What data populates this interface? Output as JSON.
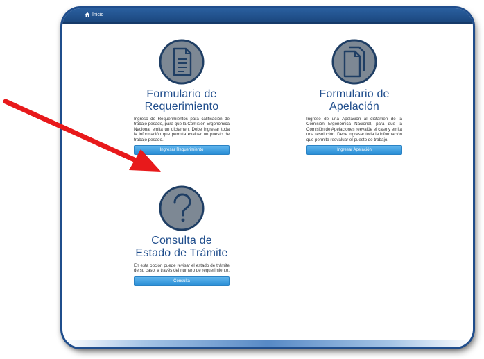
{
  "header": {
    "home_label": "Inicio"
  },
  "cards": {
    "requerimiento": {
      "icon": "document-icon",
      "title_line1": "Formulario de",
      "title_line2": "Requerimiento",
      "description": "Ingreso de Requerimientos para calificación de trabajo pesado, para que la Comisión Ergonómica Nacional emita un dictamen. Debe ingresar toda la información que permita evaluar un puesto de trabajo pesado.",
      "button_label": "Ingresar Requerimiento"
    },
    "apelacion": {
      "icon": "documents-stack-icon",
      "title_line1": "Formulario de",
      "title_line2": "Apelación",
      "description": "Ingreso de una Apelación al dictamen de la Comisión Ergonómica Nacional, para que la Comisión de Apelaciones reevalúe el caso y emita una resolución. Debe ingresar toda la información que permita reevaluar el puesto de trabajo.",
      "button_label": "Ingresar Apelación"
    },
    "consulta": {
      "icon": "question-mark-icon",
      "title_line1": "Consulta de",
      "title_line2": "Estado de Trámite",
      "description": "En esta opción puede revisar el estado de trámite de su caso, a través del número de requerimiento.",
      "button_label": "Consulta"
    }
  },
  "colors": {
    "header_bar": "#1f4d8c",
    "title": "#1f4d8c",
    "button": "#3a9be0",
    "annotation_arrow": "#e8191b"
  }
}
